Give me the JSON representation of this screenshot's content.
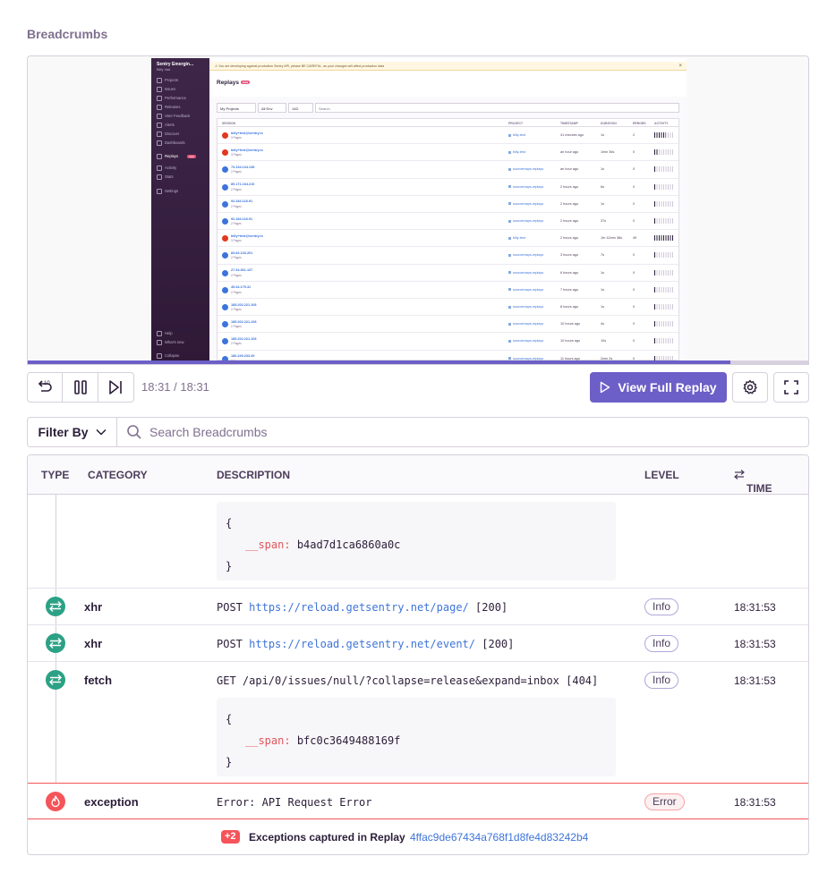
{
  "section_title": "Breadcrumbs",
  "replay": {
    "progress_fraction": 0.9,
    "mini": {
      "org_name": "Sentry Emergin...",
      "org_user": "Billy Vad",
      "alert": "You are developing against production Sentry API, please BE CAREFUL, as your changes will affect production data",
      "title": "Replays",
      "title_badge": "beta",
      "nav": [
        "Projects",
        "Issues",
        "Performance",
        "Releases",
        "User Feedback",
        "Alerts",
        "Discover",
        "Dashboards",
        "Replays",
        "Activity",
        "Stats",
        "Settings",
        "Help",
        "What's new",
        "Collapse"
      ],
      "replays_badge": "new",
      "filters": [
        "My Projects",
        "All Env",
        "14D",
        "Search"
      ],
      "columns": [
        "SESSION",
        "PROJECT",
        "TIMESTAMP",
        "DURATION",
        "ERRORS",
        "ACTIVITY"
      ],
      "rows": [
        {
          "name": "billy+test@sentry.io",
          "pages": "3 Pages",
          "project": "billy-test",
          "time": "41 minutes ago",
          "duration": "1s",
          "errors": "2",
          "activity": 0.6,
          "red": true
        },
        {
          "name": "billy+test@sentry.io",
          "pages": "3 Pages",
          "project": "billy-test",
          "time": "an hour ago",
          "duration": "1min 36s",
          "errors": "0",
          "activity": 0.2,
          "red": true
        },
        {
          "name": "73.134.134.138",
          "pages": "2 Pages",
          "project": "sourcemaps-replays",
          "time": "an hour ago",
          "duration": "1s",
          "errors": "0",
          "activity": 0.1,
          "red": false
        },
        {
          "name": "89.171.164.210",
          "pages": "2 Pages",
          "project": "sourcemaps-replays",
          "time": "2 hours ago",
          "duration": "6s",
          "errors": "0",
          "activity": 0.1,
          "red": false
        },
        {
          "name": "92.184.118.91",
          "pages": "2 Pages",
          "project": "sourcemaps-replays",
          "time": "2 hours ago",
          "duration": "1s",
          "errors": "0",
          "activity": 0.1,
          "red": false
        },
        {
          "name": "92.184.118.91",
          "pages": "2 Pages",
          "project": "sourcemaps-replays",
          "time": "2 hours ago",
          "duration": "37s",
          "errors": "0",
          "activity": 0.1,
          "red": false
        },
        {
          "name": "billy+test@sentry.io",
          "pages": "3 Pages",
          "project": "billy-test",
          "time": "2 hours ago",
          "duration": "1hr 42min 38s",
          "errors": "49",
          "activity": 1.0,
          "red": true
        },
        {
          "name": "83.84.133.201",
          "pages": "2 Pages",
          "project": "sourcemaps-replays",
          "time": "3 hours ago",
          "duration": "7s",
          "errors": "0",
          "activity": 0.1,
          "red": false
        },
        {
          "name": "27.34.361.137",
          "pages": "2 Pages",
          "project": "sourcemaps-replays",
          "time": "6 hours ago",
          "duration": "1s",
          "errors": "0",
          "activity": 0.1,
          "red": false
        },
        {
          "name": "49.34.179.31",
          "pages": "2 Pages",
          "project": "sourcemaps-replays",
          "time": "7 hours ago",
          "duration": "1s",
          "errors": "0",
          "activity": 0.1,
          "red": false
        },
        {
          "name": "185.202.221.108",
          "pages": "2 Pages",
          "project": "sourcemaps-replays",
          "time": "8 hours ago",
          "duration": "1s",
          "errors": "0",
          "activity": 0.1,
          "red": false
        },
        {
          "name": "185.202.221.108",
          "pages": "2 Pages",
          "project": "sourcemaps-replays",
          "time": "10 hours ago",
          "duration": "4s",
          "errors": "0",
          "activity": 0.1,
          "red": false
        },
        {
          "name": "185.202.221.108",
          "pages": "2 Pages",
          "project": "sourcemaps-replays",
          "time": "10 hours ago",
          "duration": "10s",
          "errors": "0",
          "activity": 0.1,
          "red": false
        },
        {
          "name": "180.249.233.49",
          "pages": "2 Pages",
          "project": "sourcemaps-replays",
          "time": "11 hours ago",
          "duration": "2min 2s",
          "errors": "0",
          "activity": 0.1,
          "red": false
        }
      ]
    }
  },
  "controls": {
    "time": "18:31 / 18:31",
    "view_full": "View Full Replay"
  },
  "filter": {
    "filter_by": "Filter By",
    "search_placeholder": "Search Breadcrumbs"
  },
  "table": {
    "headers": {
      "type": "TYPE",
      "category": "CATEGORY",
      "description": "DESCRIPTION",
      "level": "LEVEL",
      "time": "TIME"
    },
    "top_code": {
      "open": "{",
      "key": "__span:",
      "value": "b4ad7d1ca6860a0c",
      "close": "}"
    },
    "rows": [
      {
        "category": "xhr",
        "method": "POST",
        "url": "https://reload.getsentry.net/page/",
        "status": "[200]",
        "level": "Info",
        "time": "18:31:53"
      },
      {
        "category": "xhr",
        "method": "POST",
        "url": "https://reload.getsentry.net/event/",
        "status": "[200]",
        "level": "Info",
        "time": "18:31:53"
      },
      {
        "category": "fetch",
        "desc": "GET /api/0/issues/null/?collapse=release&expand=inbox [404]",
        "level": "Info",
        "time": "18:31:53"
      }
    ],
    "fetch_code": {
      "open": "{",
      "key": "__span:",
      "value": "bfc0c3649488169f",
      "close": "}"
    },
    "exception": {
      "category": "exception",
      "desc_prefix": "Error:",
      "desc": "API Request Error",
      "level": "Error",
      "time": "18:31:53"
    },
    "footer": {
      "count": "+2",
      "text": "Exceptions captured in Replay",
      "link": "4ffac9de67434a768f1d8fe4d83242b4"
    }
  }
}
